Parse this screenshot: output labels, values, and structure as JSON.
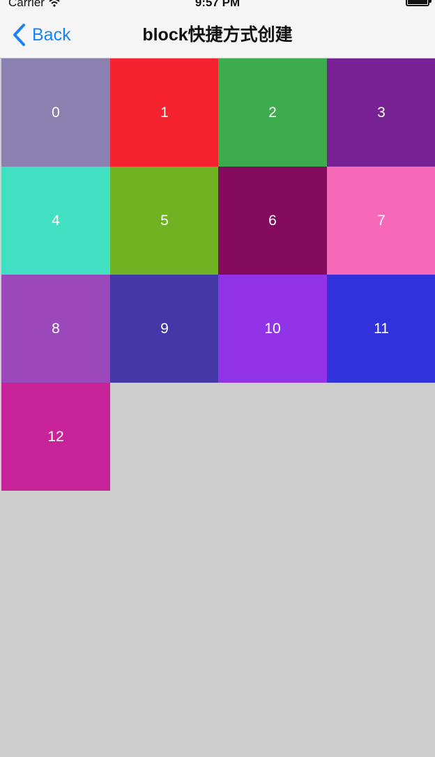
{
  "status_bar": {
    "carrier": "Carrier",
    "time": "9:57 PM"
  },
  "nav": {
    "back_label": "Back",
    "title": "block快捷方式创建",
    "accent_color": "#1a82fb"
  },
  "grid": {
    "columns": 4,
    "cells": [
      {
        "label": "0",
        "color": "#8b80b0"
      },
      {
        "label": "1",
        "color": "#f6222f"
      },
      {
        "label": "2",
        "color": "#3cac4e"
      },
      {
        "label": "3",
        "color": "#772195"
      },
      {
        "label": "4",
        "color": "#41e0c2"
      },
      {
        "label": "5",
        "color": "#6fb322"
      },
      {
        "label": "6",
        "color": "#830a5c"
      },
      {
        "label": "7",
        "color": "#f668b8"
      },
      {
        "label": "8",
        "color": "#9b48bb"
      },
      {
        "label": "9",
        "color": "#4438a8"
      },
      {
        "label": "10",
        "color": "#9133e6"
      },
      {
        "label": "11",
        "color": "#3232dc"
      },
      {
        "label": "12",
        "color": "#c9239a"
      }
    ]
  }
}
